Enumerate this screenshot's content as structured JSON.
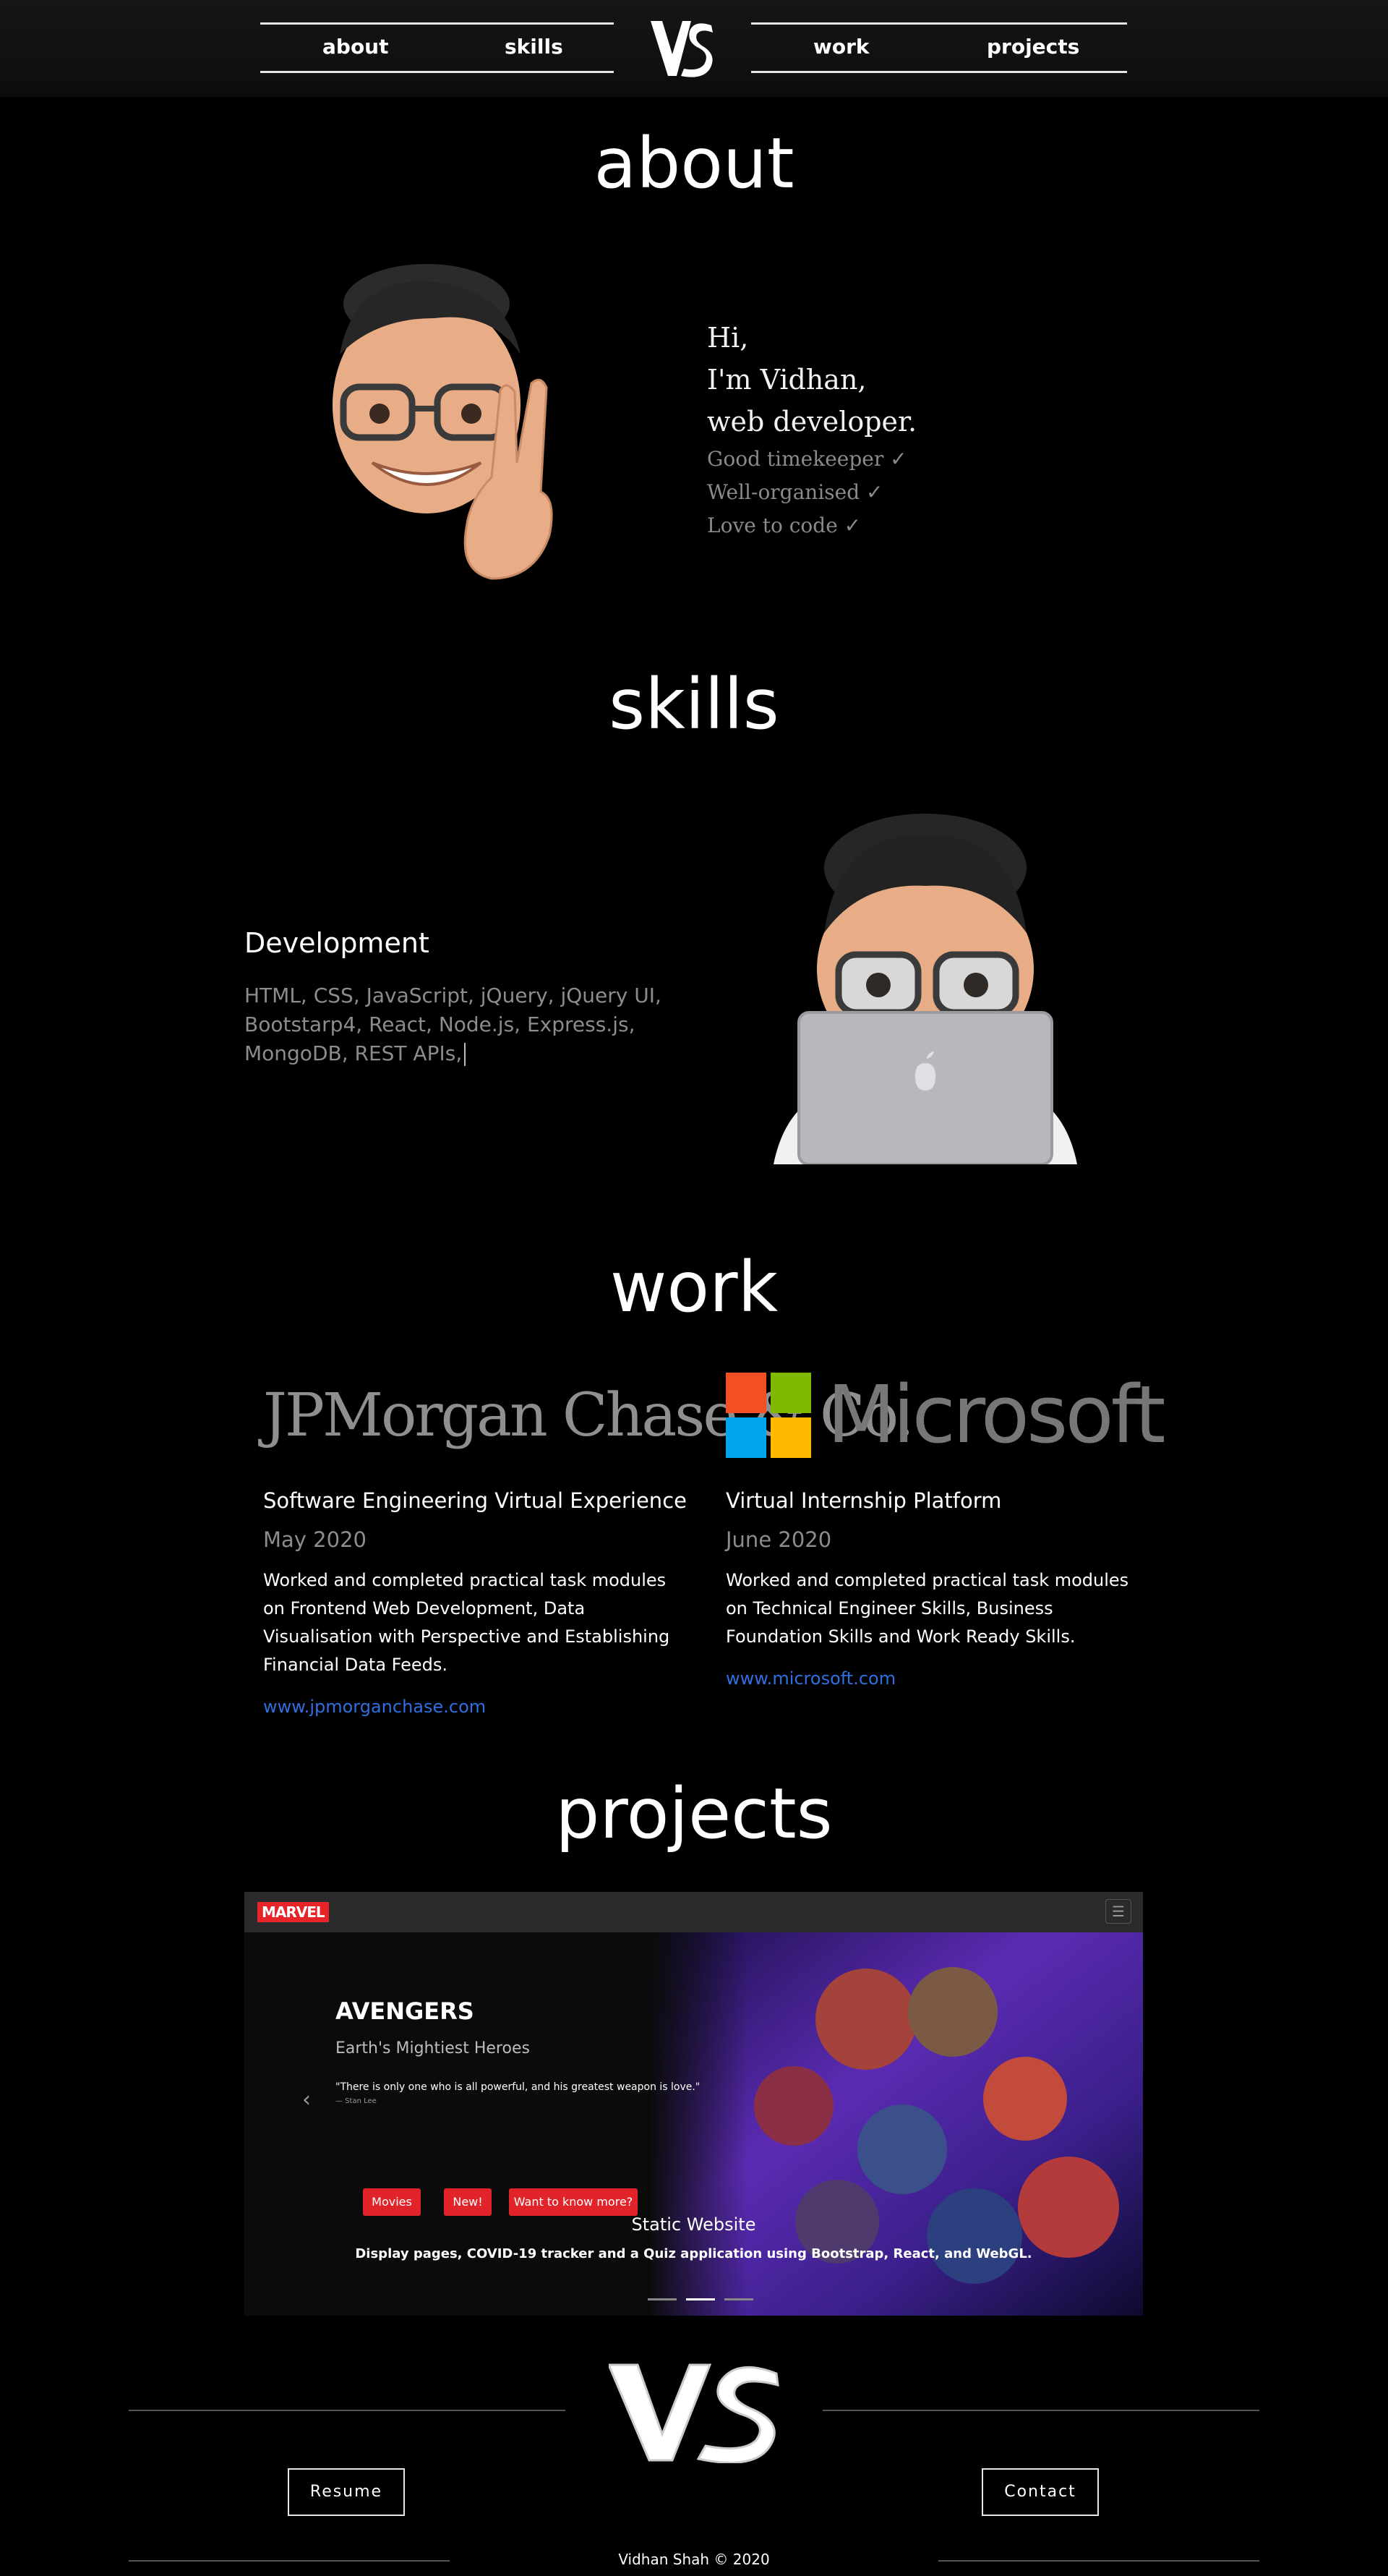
{
  "nav": {
    "about": "about",
    "skills": "skills",
    "work": "work",
    "projects": "projects"
  },
  "about": {
    "title": "about",
    "greeting": "Hi,",
    "name_line": "I'm Vidhan,",
    "role_line": "web developer.",
    "traits": [
      "Good timekeeper ✓",
      "Well-organised ✓",
      "Love to code ✓"
    ]
  },
  "skills": {
    "title": "skills",
    "heading": "Development",
    "list": "HTML, CSS, JavaScript, jQuery, jQuery UI, Bootstarp4, React, Node.js, Express.js, MongoDB, REST APIs,"
  },
  "work": {
    "title": "work",
    "cards": [
      {
        "logo_text": "JPMorgan Chase & Co.",
        "title": "Software Engineering Virtual Experience",
        "date": "May 2020",
        "desc": "Worked and completed practical task modules on Frontend Web Development, Data Visualisation with Perspective and Establishing Financial Data Feeds.",
        "link": "www.jpmorganchase.com"
      },
      {
        "logo_text": "Microsoft",
        "title": "Virtual Internship Platform",
        "date": "June 2020",
        "desc": "Worked and completed practical task modules on Technical Engineer Skills, Business Foundation Skills and Work Ready Skills.",
        "link": "www.microsoft.com"
      }
    ]
  },
  "projects": {
    "title": "projects",
    "slide": {
      "brand": "MARVEL",
      "heading": "AVENGERS",
      "tagline": "Earth's Mightiest Heroes",
      "quote": "\"There is only one who is all powerful, and his greatest weapon is love.\"",
      "quote_source": "— Stan Lee",
      "buttons": [
        "Movies",
        "New!",
        "Want to know more?"
      ],
      "caption_title": "Static Website",
      "caption_desc": "Display pages, COVID-19 tracker and a Quiz application using Bootstrap, React, and WebGL."
    }
  },
  "footer": {
    "resume": "Resume",
    "contact": "Contact",
    "copyright": "Vidhan Shah © 2020"
  },
  "colors": {
    "background": "#000000",
    "link": "#2f6fe0",
    "muted": "#8c8c8c",
    "accent_red": "#e0242a"
  }
}
